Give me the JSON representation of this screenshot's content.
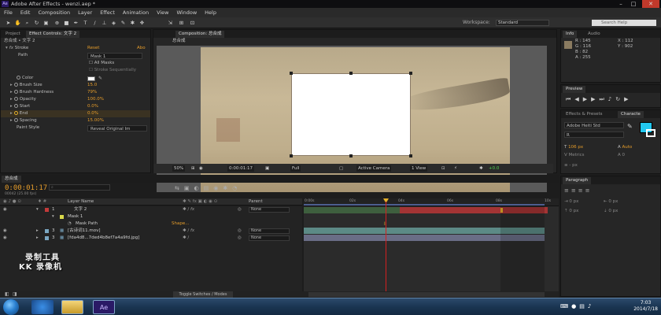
{
  "window": {
    "title": "Adobe After Effects - wenzi.aep *",
    "app_logo": "Ae",
    "controls": [
      "minimize-icon",
      "maximize-icon",
      "close-icon"
    ]
  },
  "menu": [
    "File",
    "Edit",
    "Composition",
    "Layer",
    "Effect",
    "Animation",
    "View",
    "Window",
    "Help"
  ],
  "toolbar": {
    "workspace_label": "Workspace:",
    "workspace_value": "Standard",
    "search_placeholder": "Search Help"
  },
  "effect_controls": {
    "tabs": [
      "Project",
      "Effect Controls: 文字 2"
    ],
    "breadcrumb": "总合成 • 文字 2",
    "effect_name": "Stroke",
    "reset": "Reset",
    "about": "Abo",
    "path_label": "Path",
    "path_value": "Mask 1",
    "all_masks": "All Masks",
    "sequentially": "Stroke Sequentially",
    "color_label": "Color",
    "properties": [
      {
        "label": "Brush Size",
        "value": "15.0"
      },
      {
        "label": "Brush Hardness",
        "value": "79%"
      },
      {
        "label": "Opacity",
        "value": "100.0%"
      },
      {
        "label": "Start",
        "value": "0.0%"
      },
      {
        "label": "End",
        "value": "0.0%"
      },
      {
        "label": "Spacing",
        "value": "15.00%"
      }
    ],
    "paint_style_label": "Paint Style",
    "paint_style_value": "Reveal Original Im"
  },
  "composition": {
    "tab": "Composition: 总合成",
    "breadcrumb": "总合成",
    "zoom": "50%",
    "timecode": "0:00:01:17",
    "resolution": "Full",
    "camera": "Active Camera",
    "view": "1 View",
    "exposure": "+0.0"
  },
  "info": {
    "tabs": [
      "Info",
      "Audio"
    ],
    "r": "R : 145",
    "g": "G : 116",
    "b": "B : 82",
    "a": "A : 255",
    "x": "X : 112",
    "y": "Y : 902",
    "swatch_color": "#8a7b60"
  },
  "preview": {
    "tab": "Preview"
  },
  "character": {
    "tabs": [
      "Effects & Presets",
      "Characte"
    ],
    "font": "Adobe Heiti Std",
    "style": "R",
    "size": "106 px",
    "leading": "Auto",
    "kerning": "Metrics",
    "tracking": "0",
    "unit": "px",
    "fill_color": "#22c8f0"
  },
  "paragraph": {
    "tab": "Paragraph",
    "indent_left": "0 px",
    "indent_right": "0 px",
    "space_before": "0 px",
    "space_after": "0 px"
  },
  "timeline": {
    "tab": "总合成",
    "timecode": "0:00:01:17",
    "fps": "00042 (25.00 fps)",
    "col_layer_name": "Layer Name",
    "col_parent": "Parent",
    "layers": [
      {
        "num": "1",
        "name": "文字 2",
        "parent": "None",
        "color": "#c43a3a",
        "fx": "fx"
      },
      {
        "num": "",
        "name": "Mask 1",
        "parent": "",
        "color": "#d8d84a",
        "fx": ""
      },
      {
        "num": "",
        "name": "Mask Path",
        "parent": "Shape...",
        "color": "",
        "fx": ""
      },
      {
        "num": "3",
        "name": "[古诗词11.mov]",
        "parent": "None",
        "color": "#7aa7c2",
        "fx": "fx"
      },
      {
        "num": "3",
        "name": "[fda4d8...7ded4b8ef7a4a9fd.jpg]",
        "parent": "None",
        "color": "#7aa7c2",
        "fx": ""
      }
    ],
    "ruler_ticks": [
      "0:00s",
      "02s",
      "04s",
      "06s",
      "08s",
      "10s"
    ],
    "toggle_label": "Toggle Switches / Modes"
  },
  "watermark": {
    "line1": "录制工具",
    "line2": "KK 录像机"
  },
  "taskbar": {
    "time": "7:03",
    "date": "2014/7/18",
    "apps": [
      "start-icon",
      "ie-icon",
      "explorer-icon",
      "after-effects-icon"
    ]
  }
}
